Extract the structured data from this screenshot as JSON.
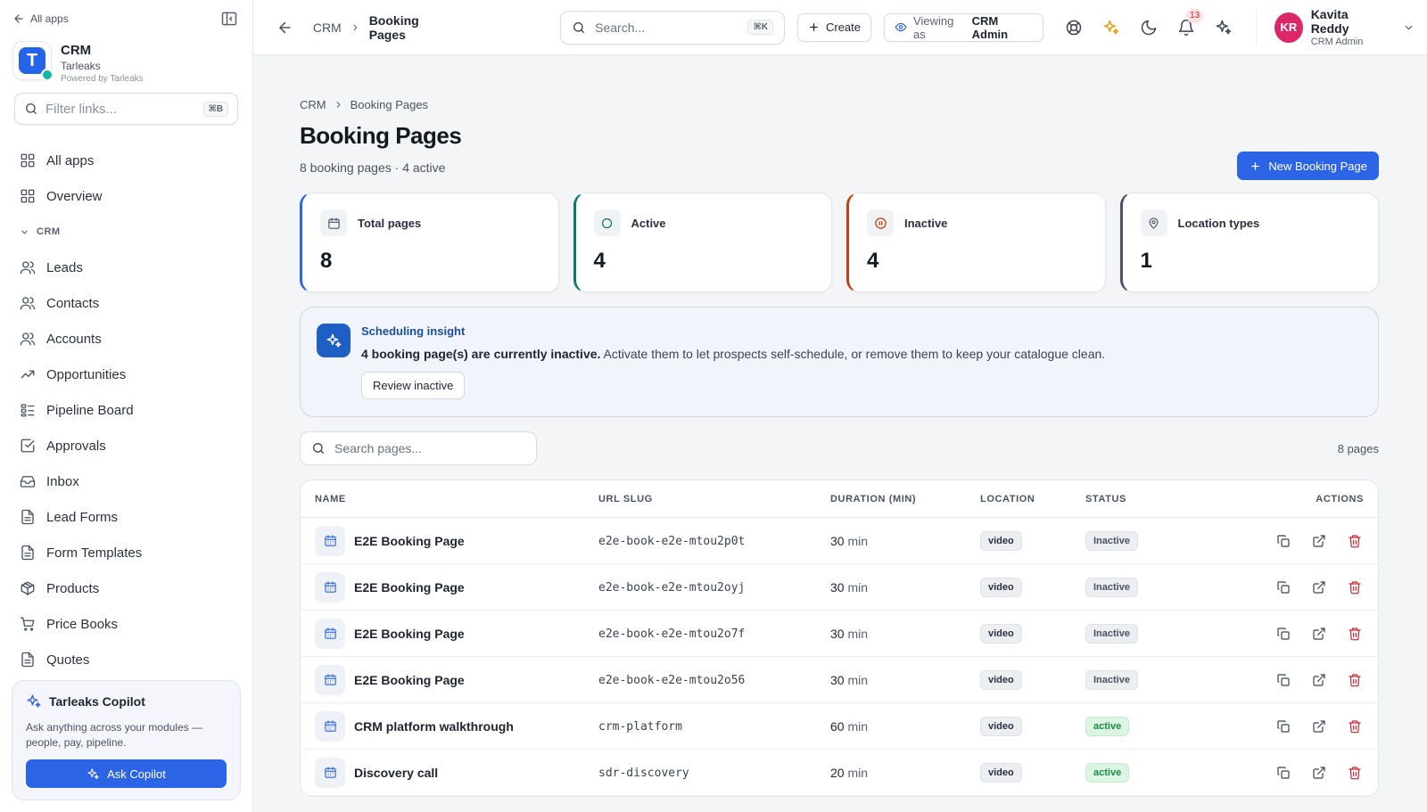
{
  "sidebar": {
    "all_apps_link": "All apps",
    "brand": {
      "name": "CRM",
      "org": "Tarleaks",
      "powered": "Powered by Tarleaks",
      "logo_letter": "T"
    },
    "filter": {
      "placeholder": "Filter links...",
      "shortcut": "⌘B"
    },
    "top_items": [
      {
        "label": "All apps",
        "icon": "grid-icon"
      },
      {
        "label": "Overview",
        "icon": "grid-icon"
      }
    ],
    "section_label": "CRM",
    "items": [
      {
        "label": "Leads",
        "icon": "users-icon"
      },
      {
        "label": "Contacts",
        "icon": "users-icon"
      },
      {
        "label": "Accounts",
        "icon": "users-icon"
      },
      {
        "label": "Opportunities",
        "icon": "trending-up-icon"
      },
      {
        "label": "Pipeline Board",
        "icon": "list-icon"
      },
      {
        "label": "Approvals",
        "icon": "check-square-icon"
      },
      {
        "label": "Inbox",
        "icon": "inbox-icon"
      },
      {
        "label": "Lead Forms",
        "icon": "file-text-icon"
      },
      {
        "label": "Form Templates",
        "icon": "file-text-icon"
      },
      {
        "label": "Products",
        "icon": "package-icon"
      },
      {
        "label": "Price Books",
        "icon": "cart-icon"
      },
      {
        "label": "Quotes",
        "icon": "file-text-icon"
      }
    ],
    "copilot": {
      "title": "Tarleaks Copilot",
      "description": "Ask anything across your modules — people, pay, pipeline.",
      "button": "Ask Copilot"
    }
  },
  "topbar": {
    "breadcrumb": [
      "CRM",
      "Booking Pages"
    ],
    "search": {
      "placeholder": "Search...",
      "shortcut": "⌘K"
    },
    "create_label": "Create",
    "viewing_prefix": "Viewing as",
    "viewing_role": "CRM Admin",
    "notification_count": "13",
    "user": {
      "initials": "KR",
      "name": "Kavita Reddy",
      "role": "CRM Admin"
    }
  },
  "page": {
    "breadcrumb": [
      "CRM",
      "Booking Pages"
    ],
    "title": "Booking Pages",
    "subtitle": "8 booking pages · 4 active",
    "new_button": "New Booking Page",
    "stats": [
      {
        "label": "Total pages",
        "value": "8",
        "icon": "calendar-icon",
        "accent": "#2c64e6"
      },
      {
        "label": "Active",
        "value": "4",
        "icon": "circle-icon",
        "accent": "#0f766e"
      },
      {
        "label": "Inactive",
        "value": "4",
        "icon": "pause-circle-icon",
        "accent": "#c2410c"
      },
      {
        "label": "Location types",
        "value": "1",
        "icon": "map-pin-icon",
        "accent": "#4b5262"
      }
    ],
    "insight": {
      "title": "Scheduling insight",
      "bold_text": "4 booking page(s) are currently inactive.",
      "text": " Activate them to let prospects self-schedule, or remove them to keep your catalogue clean.",
      "button": "Review inactive"
    },
    "search": {
      "placeholder": "Search pages..."
    },
    "count_label": "8 pages",
    "table": {
      "columns": [
        "NAME",
        "URL SLUG",
        "DURATION (MIN)",
        "LOCATION",
        "STATUS",
        "ACTIONS"
      ],
      "unit": "min",
      "rows": [
        {
          "name": "E2E Booking Page",
          "slug": "e2e-book-e2e-mtou2p0t",
          "duration": "30",
          "location": "video",
          "status": "Inactive"
        },
        {
          "name": "E2E Booking Page",
          "slug": "e2e-book-e2e-mtou2oyj",
          "duration": "30",
          "location": "video",
          "status": "Inactive"
        },
        {
          "name": "E2E Booking Page",
          "slug": "e2e-book-e2e-mtou2o7f",
          "duration": "30",
          "location": "video",
          "status": "Inactive"
        },
        {
          "name": "E2E Booking Page",
          "slug": "e2e-book-e2e-mtou2o56",
          "duration": "30",
          "location": "video",
          "status": "Inactive"
        },
        {
          "name": "CRM platform walkthrough",
          "slug": "crm-platform",
          "duration": "60",
          "location": "video",
          "status": "active"
        },
        {
          "name": "Discovery call",
          "slug": "sdr-discovery",
          "duration": "20",
          "location": "video",
          "status": "active"
        }
      ]
    }
  },
  "colors": {
    "primary": "#2c64e6",
    "danger": "#c2262e",
    "success": "#1a8a43"
  }
}
